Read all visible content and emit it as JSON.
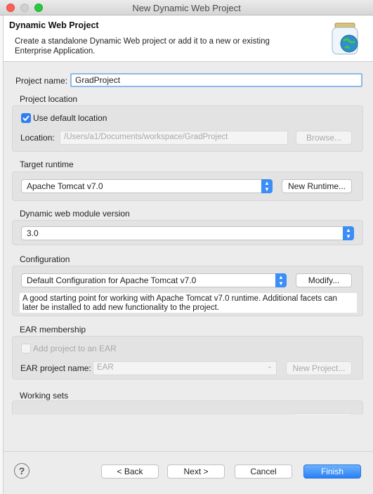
{
  "window": {
    "title": "New Dynamic Web Project"
  },
  "header": {
    "title": "Dynamic Web Project",
    "description": "Create a standalone Dynamic Web project or add it to a new or existing Enterprise Application.",
    "icon": "web-project-jar-globe-icon"
  },
  "project_name": {
    "label": "Project name:",
    "value": "GradProject"
  },
  "project_location": {
    "group_label": "Project location",
    "use_default_label": "Use default location",
    "use_default_checked": true,
    "location_label": "Location:",
    "location_value": "/Users/a1/Documents/workspace/GradProject",
    "browse_label": "Browse..."
  },
  "target_runtime": {
    "group_label": "Target runtime",
    "selected": "Apache Tomcat v7.0",
    "new_runtime_label": "New Runtime..."
  },
  "module_version": {
    "group_label": "Dynamic web module version",
    "selected": "3.0"
  },
  "configuration": {
    "group_label": "Configuration",
    "selected": "Default Configuration for Apache Tomcat v7.0",
    "modify_label": "Modify...",
    "description": "A good starting point for working with Apache Tomcat v7.0 runtime. Additional facets can later be installed to add new functionality to the project."
  },
  "ear": {
    "group_label": "EAR membership",
    "add_label": "Add project to an EAR",
    "project_name_label": "EAR project name:",
    "project_name_value": "EAR",
    "new_project_label": "New Project..."
  },
  "working_sets": {
    "group_label": "Working sets"
  },
  "footer": {
    "help_icon": "?",
    "back_label": "< Back",
    "next_label": "Next >",
    "cancel_label": "Cancel",
    "finish_label": "Finish"
  },
  "colors": {
    "accent": "#3b8df7",
    "checkbox": "#2f7ef5"
  }
}
